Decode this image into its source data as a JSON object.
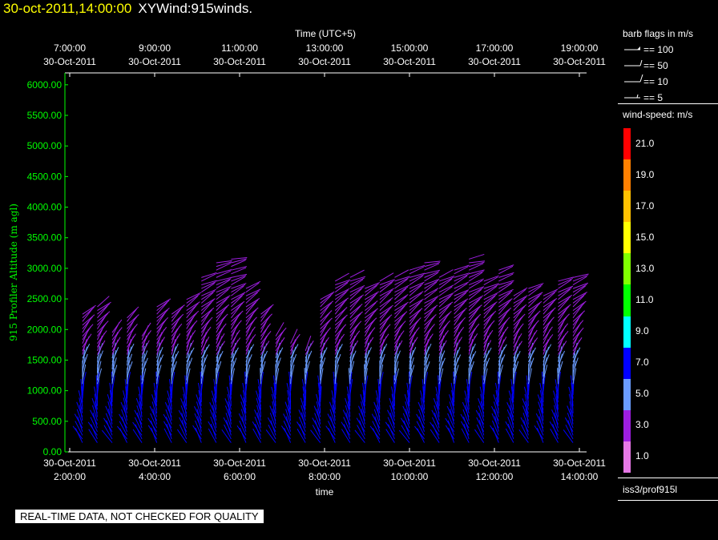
{
  "header": {
    "date": "30-oct-2011,14:00:00",
    "name": "XYWind:915winds."
  },
  "qc_note": "REAL-TIME DATA, NOT CHECKED FOR QUALITY",
  "side": {
    "barb_title": "barb flags in m/s",
    "barb_flags": [
      "== 100",
      "== 50",
      "== 10",
      "== 5"
    ],
    "speed_title": "wind-speed: m/s",
    "speed_scale": [
      {
        "label": "21.0",
        "color": "#ff0000"
      },
      {
        "label": "19.0",
        "color": "#ff8000"
      },
      {
        "label": "17.0",
        "color": "#ffc000"
      },
      {
        "label": "15.0",
        "color": "#ffff00"
      },
      {
        "label": "13.0",
        "color": "#80ff00"
      },
      {
        "label": "11.0",
        "color": "#00ff00"
      },
      {
        "label": "9.0",
        "color": "#00ffff"
      },
      {
        "label": "7.0",
        "color": "#0000ff"
      },
      {
        "label": "5.0",
        "color": "#6a9cff"
      },
      {
        "label": "3.0",
        "color": "#9d1ee0"
      },
      {
        "label": "1.0",
        "color": "#e678e6"
      }
    ],
    "source": "iss3/prof915l"
  },
  "chart_data": {
    "type": "scatter",
    "ylabel": "915 Profiler Altitude (m agl)",
    "ylim": [
      0,
      6000
    ],
    "y_ticks": [
      "0.00",
      "500.00",
      "1000.00",
      "1500.00",
      "2000.00",
      "2500.00",
      "3000.00",
      "3500.00",
      "4000.00",
      "4500.00",
      "5000.00",
      "5500.00",
      "6000.00"
    ],
    "xlabel": "time",
    "x_ticks_bottom": [
      [
        "30-Oct-2011",
        "2:00:00"
      ],
      [
        "30-Oct-2011",
        "4:00:00"
      ],
      [
        "30-Oct-2011",
        "6:00:00"
      ],
      [
        "30-Oct-2011",
        "8:00:00"
      ],
      [
        "30-Oct-2011",
        "10:00:00"
      ],
      [
        "30-Oct-2011",
        "12:00:00"
      ],
      [
        "30-Oct-2011",
        "14:00:00"
      ]
    ],
    "xlabel_top": "Time (UTC+5)",
    "x_ticks_top": [
      [
        "7:00:00",
        "30-Oct-2011"
      ],
      [
        "9:00:00",
        "30-Oct-2011"
      ],
      [
        "11:00:00",
        "30-Oct-2011"
      ],
      [
        "13:00:00",
        "30-Oct-2011"
      ],
      [
        "15:00:00",
        "30-Oct-2011"
      ],
      [
        "17:00:00",
        "30-Oct-2011"
      ],
      [
        "19:00:00",
        "30-Oct-2011"
      ]
    ],
    "xlim_hours": [
      2.0,
      14.3
    ],
    "profile_times_hours": [
      2.3,
      2.65,
      3.0,
      3.35,
      3.7,
      4.05,
      4.4,
      4.75,
      5.1,
      5.45,
      5.8,
      6.15,
      6.5,
      6.85,
      7.2,
      7.55,
      7.9,
      8.25,
      8.6,
      8.95,
      9.3,
      9.65,
      10.0,
      10.35,
      10.7,
      11.05,
      11.4,
      11.75,
      12.1,
      12.45,
      12.8,
      13.15,
      13.5,
      13.85
    ],
    "profile_tops_m": [
      2300,
      2400,
      2000,
      2200,
      1900,
      2400,
      2300,
      2500,
      2900,
      3100,
      3200,
      2700,
      2300,
      1900,
      1800,
      1700,
      2500,
      2800,
      2900,
      2700,
      2800,
      2900,
      3000,
      3100,
      2900,
      3000,
      3200,
      2800,
      3000,
      2600,
      2700,
      2600,
      2800,
      2900
    ],
    "speed_by_altitude": [
      {
        "altitude_m": 200,
        "speed_ms": 6
      },
      {
        "altitude_m": 800,
        "speed_ms": 7
      },
      {
        "altitude_m": 1300,
        "speed_ms": 5
      },
      {
        "altitude_m": 1800,
        "speed_ms": 3
      },
      {
        "altitude_m": 2500,
        "speed_ms": 2
      },
      {
        "altitude_m": 3100,
        "speed_ms": 2
      }
    ],
    "grid": false
  }
}
